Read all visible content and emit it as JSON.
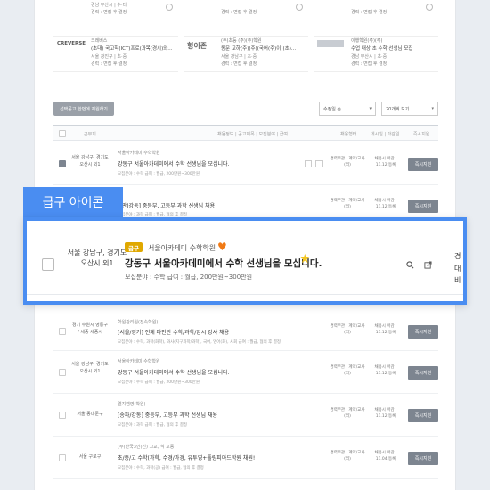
{
  "cards": [
    {
      "logo": "",
      "company": "",
      "title": "",
      "region": "경남 부산시 | 수·다",
      "exp": "경력 : 면접 후 결정"
    },
    {
      "logo": "",
      "company": "",
      "title": "",
      "region": "",
      "exp": "경력 : 면접 후 결정"
    },
    {
      "logo": "",
      "company": "",
      "title": "",
      "region": "",
      "exp": "경력 : 면접 후 결정"
    },
    {
      "logo": "CREVERSE",
      "company": "크레버스",
      "title": "(초대) 국고학(ICT)프로(과목(경시)와...",
      "region": "서울 광진구 | 초·중",
      "exp": "경력 : 면접 후 결정"
    },
    {
      "logo": "형이존",
      "company": "(주)초등 (주)(주)학원",
      "title": "동문 교하(주)(주)(국어(주)이)(초)...",
      "region": "서울 강남구 | 초·중",
      "exp": "경력 : 면접 후 결정"
    },
    {
      "logo": "",
      "company": "이행학원(주)(주)",
      "title": "수업 대상 초 수학 선생님 모집",
      "region": "경남 부산시 | 초·중",
      "exp": "경력 : 면접 후 결정"
    }
  ],
  "toolbar": {
    "left_button": "선택공고 한번에 지원하기",
    "sort": "수정일 순",
    "page_size": "20개씩 보기"
  },
  "thead": {
    "region": "근무지",
    "info": "채용정보 | 공고제목 | 모집분야 | 급여",
    "type": "채용형태",
    "date": "게시일 | 마감일",
    "apply": "즉시지원"
  },
  "callout": {
    "label": "급구 아이콘",
    "location": "서울 강남구, 경기도 오산시 외1",
    "badge": "급구",
    "company": "서울아카데미 수학학원",
    "title": "강동구 서울아카데미에서 수학 선생님을 모십니다.",
    "subtitle": "모집분야 : 수학    급여 : 월급, 200만원~300만원",
    "edge_top": "경",
    "edge_bottom": "대비"
  },
  "rows": [
    {
      "location": "서울 강남구, 경기도 오산시 외1",
      "company": "서울아카데미 수학학원",
      "title": "강동구 서울아카데미에서 수학 선생님을 모십니다.",
      "sub": "모집분야 : 수학    급여 : 월급, 200만원~300만원",
      "type": "경력무관 | 계약/교사(외)",
      "date": "채용시 마감 | 11.12 등록",
      "apply": "즉시지원",
      "checked": true
    },
    {
      "location": "",
      "company": "",
      "title": "[(판)강동] 중등부, 고등부 과학 선생님 채용",
      "sub": "모집분야 : 과학  급여 : 월급, 협의 후 결정",
      "type": "경력무관 | 계약/교사(외)",
      "date": "채용시 마감 | 11.12 등록",
      "apply": "즉시지원",
      "checked": false
    },
    {
      "location": "경기 수원시 영통구 / 세종 세종시",
      "company": "학원관리원(전속학원)",
      "title": "[서울/경기] 전체 파인만 수학/과학/입시 강사 채용",
      "sub": "모집분야 : 수학, 과학(화학), 과사(지구과학/과학), 국어, 영어(화), 사회    급여 : 월급, 협의 후 결정",
      "type": "경력무관 | 계약/교사(외)",
      "date": "채용시 마감 | 11.12 등록",
      "apply": "즉시지원",
      "checked": false
    },
    {
      "location": "서울 강남구, 경기도 오산시 외1",
      "company": "서울아카데미 수학학원",
      "title": "강동구 서울아카데미에서 수학 선생님을 모십니다.",
      "sub": "모집분야 : 수학  급여 : 월급, 200만원~300만원",
      "type": "경력무관 | 계약/교사(외)",
      "date": "채용시 마감 | 11.12 등록",
      "apply": "즉시지원",
      "checked": false
    },
    {
      "location": "서울 동대문구",
      "company": "엘지엠영(학원)",
      "title": "[송파/강동] 중등부, 고등부 과학 선생님 채용",
      "sub": "모집분야 : 과학  급여 : 월급, 협의 후 결정",
      "type": "경력무관 | 계약/교사(외)",
      "date": "채용시 마감 | 11.12 등록",
      "apply": "즉시지원",
      "checked": false
    },
    {
      "location": "서울 구로구",
      "company": "(주)한국3인(신) 고교, 식 고등",
      "title": "초/중/고 수학(과학, 수경/과경, 유투영+풀링피아드학원 채원!",
      "sub": "모집분야 : 수학, 과학(공)  급여 : 월급, 협의 후 결정",
      "type": "경력무관 | 계약/교사(외)",
      "date": "채용시 마감 | 11.04 등록",
      "apply": "즉시지원",
      "checked": false
    }
  ],
  "colors": {
    "accent": "#4a8df1",
    "badge": "#e0a800",
    "heart": "#f07a16",
    "star": "#f3c623",
    "apply_button": "#7d8590"
  }
}
